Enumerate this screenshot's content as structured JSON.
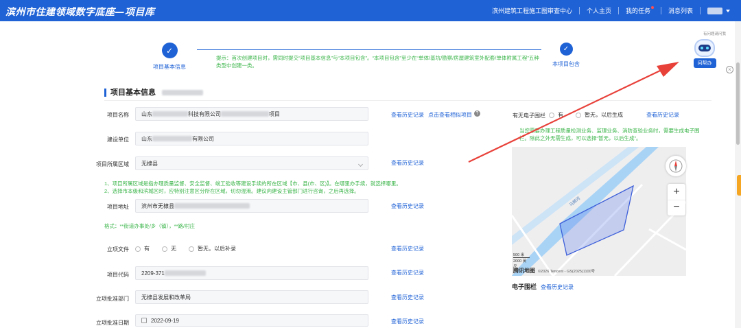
{
  "header": {
    "title": "滨州市住建领域数字底座—项目库",
    "nav": [
      {
        "label": "滨州建筑工程施工图审查中心"
      },
      {
        "label": "个人主页"
      },
      {
        "label": "我的任务"
      },
      {
        "label": "消息列表"
      }
    ]
  },
  "steps": {
    "step1": {
      "label": "项目基本信息",
      "icon": "check-icon"
    },
    "step2": {
      "label": "本项目包含",
      "icon": "check-icon"
    },
    "hint": "提示：首次创建项目时，需同时提交“项目基本信息”与“本项目包含”。“本项目包含”至少在“单体/基坑/勘察/房屋建筑室外配套/单体附属工程”五种类型中创建一类。"
  },
  "section": {
    "title": "项目基本信息"
  },
  "form": {
    "project_name": {
      "label": "项目名称",
      "value_prefix": "山东",
      "value_mid": "科技有限公司",
      "value_suffix": "项目",
      "history": "查看历史记录",
      "related": "点击查看相似项目"
    },
    "build_unit": {
      "label": "建设单位",
      "value_prefix": "山东",
      "value_suffix": "有限公司"
    },
    "region": {
      "label": "项目所属区域",
      "value": "无棣县",
      "history": "查看历史记录"
    },
    "region_note1": "1、项目所属区域是指办理质量监督、安全监督、竣工验收等建设手续的所在区域【市、县(市、区)】。在哪里办手续，就选择哪里。",
    "region_note2": "2、选择市本级和滨城区时，应特别注意区分所在区域，切勿混淆。建议向建设主管部门进行咨询，之后再选择。",
    "address": {
      "label": "项目地址",
      "value_prefix": "滨州市无棣县",
      "history": "查看历史记录"
    },
    "address_format": "格式：**街道办事处/乡（镇），**路/村庄",
    "approval_doc": {
      "label": "立项文件",
      "options": [
        "有",
        "无",
        "暂无，以后补录"
      ],
      "history": "查看历史记录"
    },
    "project_code": {
      "label": "项目代码",
      "value_prefix": "2209-371",
      "history": "查看历史记录"
    },
    "approval_dept": {
      "label": "立项批准部门",
      "value": "无棣县发展和改革局",
      "history": "查看历史记录"
    },
    "approval_date": {
      "label": "立项批准日期",
      "value": "2022-09-19",
      "history": "查看历史记录"
    }
  },
  "right": {
    "fence_label": "有无电子围栏",
    "fence_options": [
      "有",
      "暂无，以后生成"
    ],
    "fence_history": "查看历史记录",
    "fence_note": "当您需要办理工程质量检测业务、监理业务、消防查验业务时，需要生成电子围栏。除此之外无需生成，可以选择“暂无，以后生成”。",
    "map_scale1": "500 米",
    "map_scale2": "2000 英尺",
    "map_logo": "腾讯地图",
    "map_copyright": "©2026 Tencent - GS(2025)1100号",
    "river_label": "马颊河",
    "zoom_in": "+",
    "zoom_out": "−",
    "fence_title": "电子围栏",
    "fence_title_history": "查看历史记录"
  },
  "assistant": {
    "top_label": "有问题请问我",
    "button": "问帮办",
    "close": "×"
  },
  "colors": {
    "primary": "#1f62d6",
    "hint_green": "#3bb54a",
    "arrow": "#e8413a",
    "polygon": "#5a7be8"
  }
}
